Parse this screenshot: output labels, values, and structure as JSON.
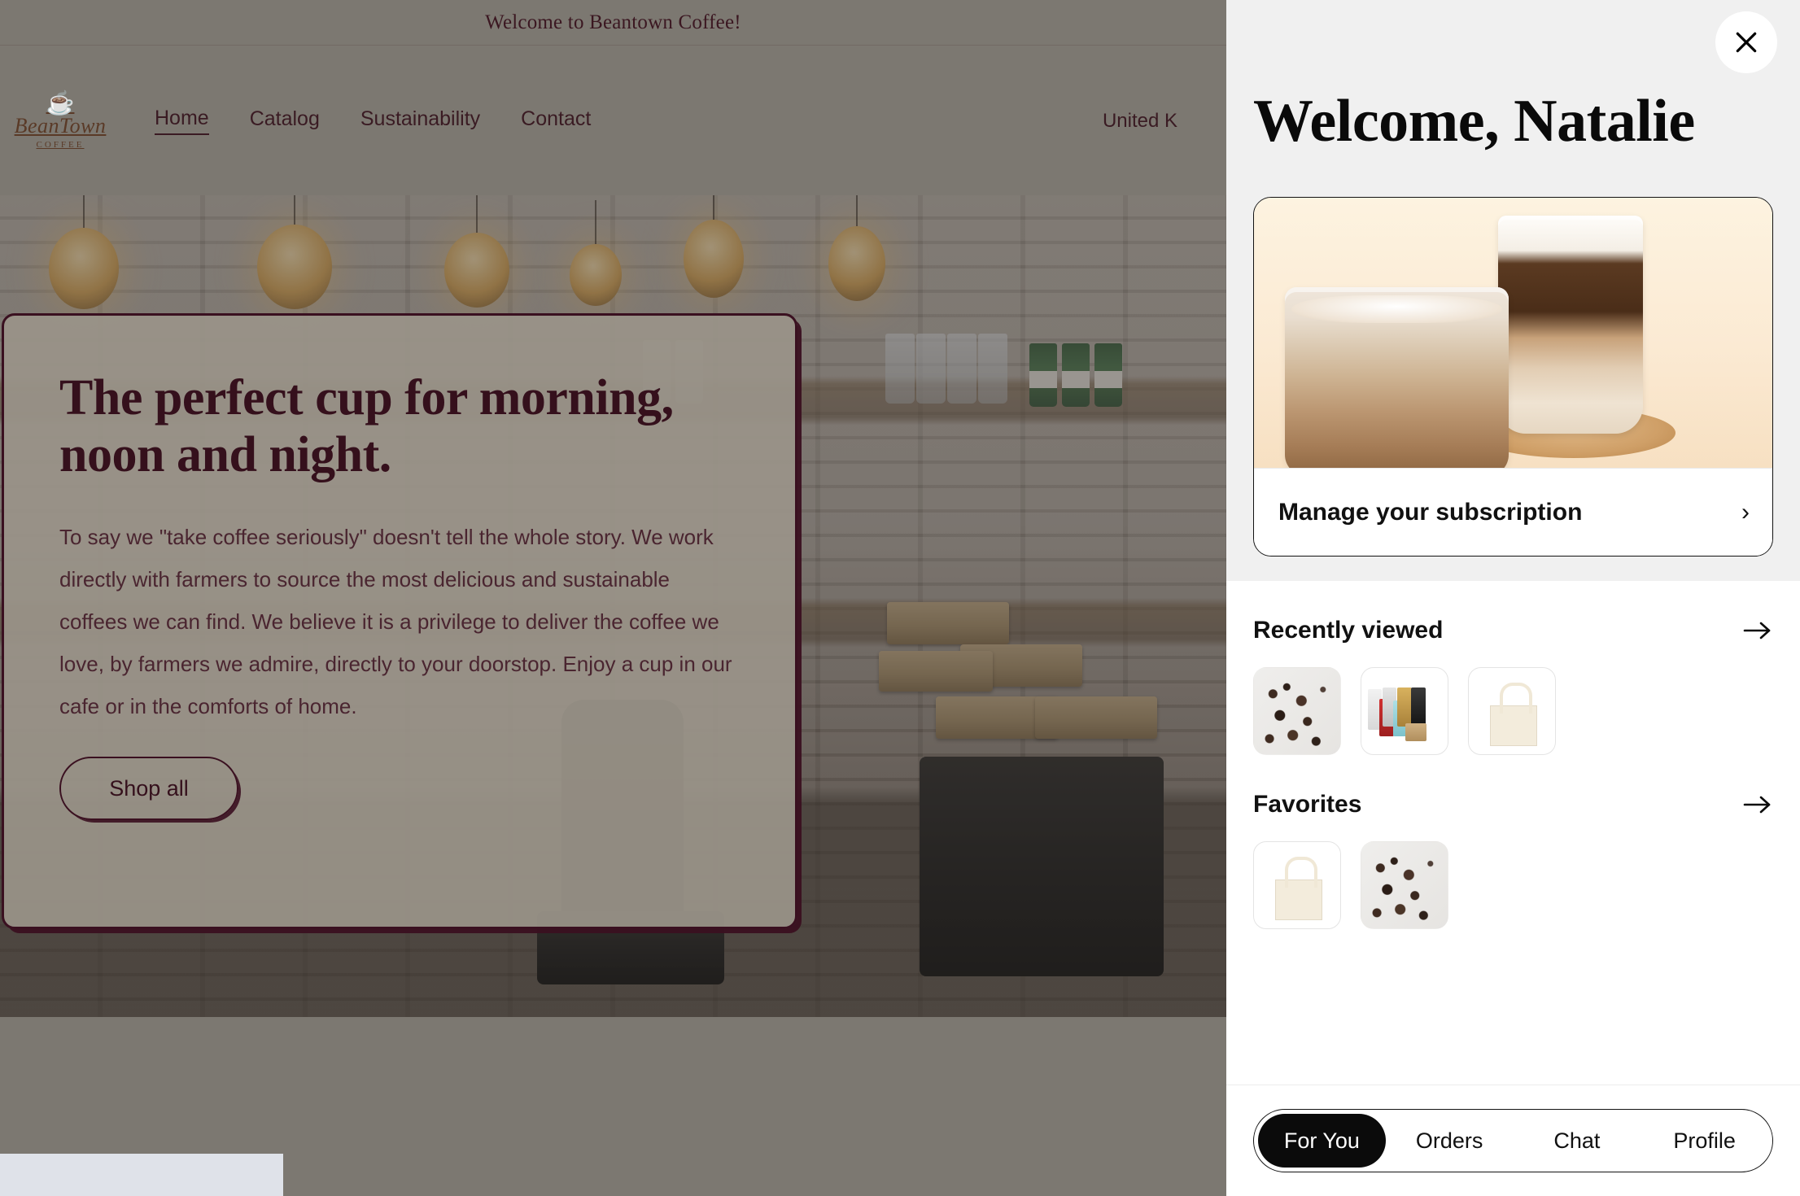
{
  "announcement": {
    "text": "Welcome to Beantown Coffee!"
  },
  "site_header": {
    "logo": {
      "wordmark": "BeanTown",
      "sub": "COFFEE",
      "cup_glyph": "☕"
    },
    "nav": [
      {
        "label": "Home",
        "active": true
      },
      {
        "label": "Catalog",
        "active": false
      },
      {
        "label": "Sustainability",
        "active": false
      },
      {
        "label": "Contact",
        "active": false
      }
    ],
    "locale": "United K"
  },
  "hero": {
    "title": "The perfect cup for morning, noon and night.",
    "body": "To say we \"take coffee seriously\" doesn't tell the whole story. We work directly with farmers to source the most delicious and sustainable coffees we can find. We believe it is a privilege to deliver the coffee we love, by farmers we admire, directly to your doorstop. Enjoy a cup in our cafe or in the comforts of home.",
    "cta": "Shop all"
  },
  "drawer": {
    "close_label": "×",
    "title": "Welcome, Natalie",
    "subscription": {
      "label": "Manage your subscription",
      "chevron": "›"
    },
    "sections": [
      {
        "title": "Recently viewed",
        "items": [
          {
            "name": "cocoa-nibs",
            "kind": "beans"
          },
          {
            "name": "coffee-bag-assortment",
            "kind": "bags"
          },
          {
            "name": "canvas-tote-bag",
            "kind": "tote"
          }
        ]
      },
      {
        "title": "Favorites",
        "items": [
          {
            "name": "canvas-tote-bag",
            "kind": "tote"
          },
          {
            "name": "cocoa-nibs",
            "kind": "beans"
          }
        ]
      }
    ],
    "tabs": [
      {
        "label": "For You",
        "active": true
      },
      {
        "label": "Orders",
        "active": false
      },
      {
        "label": "Chat",
        "active": false
      },
      {
        "label": "Profile",
        "active": false
      }
    ]
  },
  "colors": {
    "page_scrim": "#7c7871",
    "accent_dark": "#35101c",
    "drawer_top_bg": "#f0f0f0",
    "drawer_bg": "#ffffff",
    "tab_active_bg": "#0b0b0b",
    "footer_sliver": "#dfe2e9"
  }
}
